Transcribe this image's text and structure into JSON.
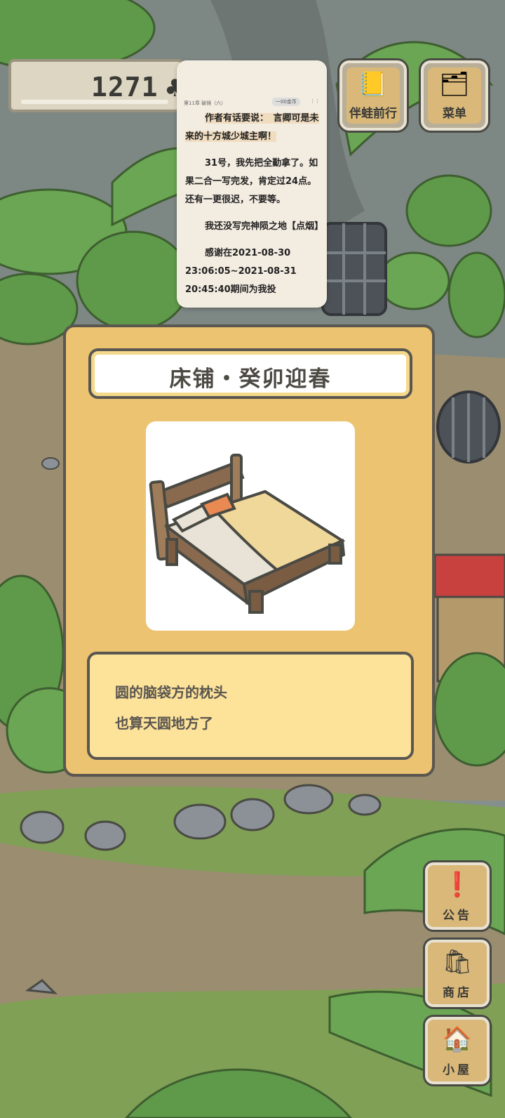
{
  "hud": {
    "clover_count": "1271",
    "clover_icon": "clover-icon"
  },
  "top_buttons": [
    {
      "label": "伴蛙前行",
      "icon": "travel-book-icon"
    },
    {
      "label": "菜单",
      "icon": "menu-cards-icon"
    }
  ],
  "reader_popup": {
    "chapter": "第11章 破镜（六）",
    "pill": "一00金币",
    "paragraphs": [
      "作者有话要说：　言卿可是未来的十方城少城主啊！",
      "31号，我先把全勤拿了。如果二合一写完发，肯定过24点。还有一更很迟，不要等。",
      "我还没写完神陨之地【点烟】",
      "感谢在2021-08-30 23:06:05~2021-08-31 20:45:40期间为我投"
    ]
  },
  "item_card": {
    "title": "床铺・癸卯迎春",
    "image": "bed-icon",
    "description": [
      "圆的脑袋方的枕头",
      "也算天圆地方了"
    ]
  },
  "side_buttons": [
    {
      "label": "公告",
      "icon": "exclamation-icon"
    },
    {
      "label": "商店",
      "icon": "shop-bags-icon"
    },
    {
      "label": "小屋",
      "icon": "house-icon"
    }
  ],
  "colors": {
    "card_bg": "#ecc371",
    "desc_bg": "#fde29a",
    "outline": "#5a5650",
    "foliage": "#5f9a4a"
  }
}
